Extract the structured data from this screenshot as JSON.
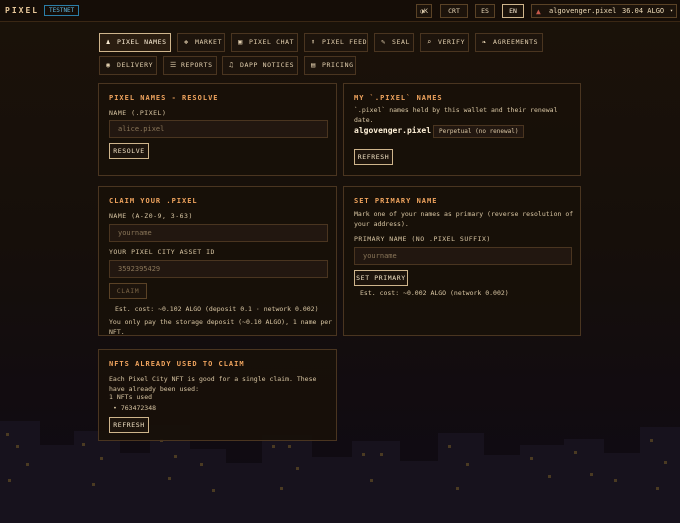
{
  "header": {
    "brand": "PIXEL",
    "network_badge": "TESTNET",
    "contrast_toggle": "◑K",
    "crt_label": "CRT",
    "languages": [
      {
        "label": "ES",
        "active": false
      },
      {
        "label": "EN",
        "active": true
      }
    ],
    "wallet": {
      "icon": "wallet-icon",
      "name": "algovenger.pixel",
      "balance": "36.04 ALGO",
      "caret": "▾"
    }
  },
  "nav": [
    {
      "label": "PIXEL NAMES",
      "icon": "♟",
      "active": true
    },
    {
      "label": "MARKET",
      "icon": "❖",
      "active": false
    },
    {
      "label": "PIXEL CHAT",
      "icon": "▣",
      "active": false
    },
    {
      "label": "PIXEL FEED",
      "icon": "⬆",
      "active": false
    },
    {
      "label": "SEAL",
      "icon": "✎",
      "active": false
    },
    {
      "label": "VERIFY",
      "icon": "⌕",
      "active": false
    },
    {
      "label": "AGREEMENTS",
      "icon": "❧",
      "active": false
    },
    {
      "label": "DELIVERY",
      "icon": "◉",
      "active": false
    },
    {
      "label": "REPORTS",
      "icon": "☰",
      "active": false
    },
    {
      "label": "DAPP NOTICES",
      "icon": "♫",
      "active": false
    },
    {
      "label": "PRICING",
      "icon": "▤",
      "active": false
    }
  ],
  "resolve": {
    "title": "PIXEL NAMES - RESOLVE",
    "label": "NAME (.PIXEL)",
    "placeholder": "alice.pixel",
    "button": "RESOLVE"
  },
  "my_names": {
    "title": "MY `.PIXEL` NAMES",
    "description": "`.pixel` names held by this wallet and their renewal date.",
    "names": [
      {
        "name": "algovenger.pixel",
        "status": "Perpetual (no renewal)"
      }
    ],
    "button": "REFRESH"
  },
  "claim": {
    "title": "CLAIM YOUR .PIXEL",
    "name_label": "NAME (A-Z0-9, 3-63)",
    "name_placeholder": "yourname",
    "asset_label": "YOUR PIXEL CITY ASSET ID",
    "asset_placeholder": "3592395429",
    "button": "CLAIM",
    "cost": "Est. cost: ~0.102 ALGO (deposit 0.1 · network 0.002)",
    "note": "You only pay the storage deposit (~0.10 ALGO), 1 name per NFT."
  },
  "primary": {
    "title": "SET PRIMARY NAME",
    "description": "Mark one of your names as primary (reverse resolution of your address).",
    "label": "PRIMARY NAME (NO .PIXEL SUFFIX)",
    "placeholder": "yourname",
    "button": "SET PRIMARY",
    "cost": "Est. cost: ~0.002 ALGO (network 0.002)"
  },
  "nfts_used": {
    "title": "NFTS ALREADY USED TO CLAIM",
    "description": "Each Pixel City NFT is good for a single claim. These have already been used:",
    "count": "1 NFTs used",
    "items": [
      "763472348"
    ],
    "button": "REFRESH"
  },
  "colors": {
    "accent_title": "#f0a45e",
    "border": "#4a3520",
    "testnet": "#5fb6df",
    "background": "#1b1209"
  }
}
